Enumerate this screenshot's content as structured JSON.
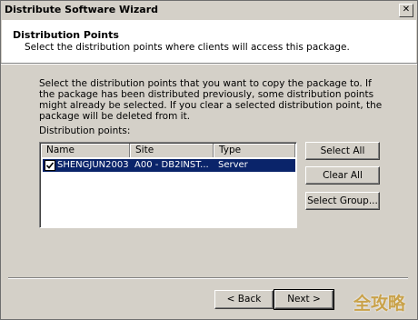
{
  "window": {
    "title": "Distribute Software Wizard",
    "close_glyph": "✕"
  },
  "header": {
    "title": "Distribution Points",
    "subtitle": "Select the distribution points where clients will access this package."
  },
  "body": {
    "description": "Select the distribution points that you want to copy the package to. If the package has been distributed previously, some distribution points might already be selected. If you clear a selected distribution point, the package will be deleted from it.",
    "list_label": "Distribution points:",
    "columns": [
      "Name",
      "Site",
      "Type"
    ],
    "rows": [
      {
        "checked": true,
        "name": "SHENGJUN2003",
        "site": "A00 - DB2INST...",
        "type": "Server"
      }
    ]
  },
  "buttons": {
    "select_all": "Select All",
    "clear_all": "Clear All",
    "select_group": "Select Group...",
    "back": "< Back",
    "next": "Next >"
  },
  "watermark": "全攻略"
}
